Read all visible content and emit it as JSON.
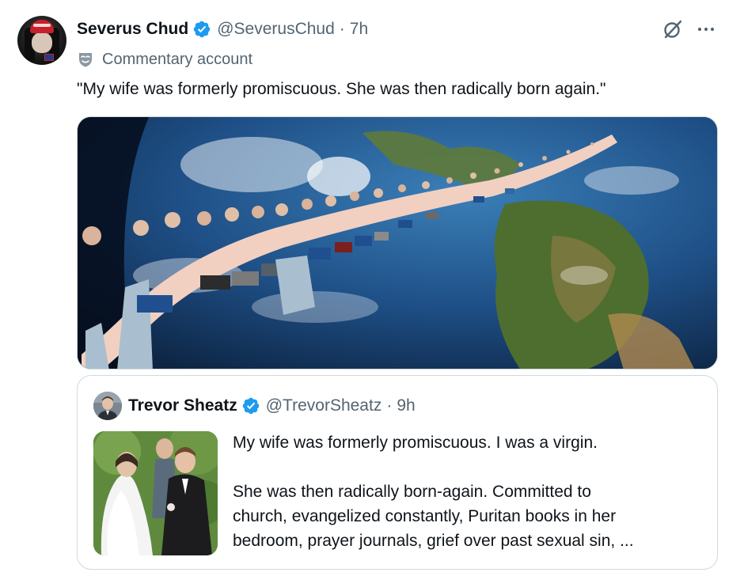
{
  "tweet": {
    "display_name": "Severus Chud",
    "handle": "@SeverusChud",
    "separator": "·",
    "time": "7h",
    "label_icon": "commentary-mask-icon",
    "label": "Commentary account",
    "text": "\"My wife was formerly promiscuous. She was then radically born again.\"",
    "media_icon": "earth-meme-image",
    "more_icon": "ellipsis-icon",
    "grok_icon": "grok-icon"
  },
  "quote": {
    "display_name": "Trevor Sheatz",
    "handle": "@TrevorSheatz",
    "separator": "·",
    "time": "9h",
    "lines": [
      "My wife was formerly promiscuous. I was a virgin.",
      "",
      "She was then radically born-again. Committed to",
      "church, evangelized constantly, Puritan books in her",
      "bedroom, prayer journals, grief over past sexual sin, ..."
    ]
  },
  "colors": {
    "verified": "#1d9bf0",
    "secondary_text": "#536471",
    "primary_text": "#0f1419",
    "border": "#cfd9de"
  }
}
